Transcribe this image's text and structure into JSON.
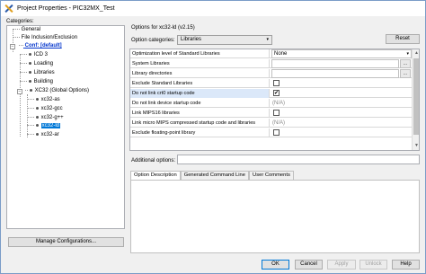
{
  "window": {
    "title": "Project Properties - PIC32MX_Test"
  },
  "categories": {
    "label": "Categories:",
    "items": [
      {
        "label": "General"
      },
      {
        "label": "File Inclusion/Exclusion"
      },
      {
        "label": "Conf: [default]"
      },
      {
        "label": "ICD 3"
      },
      {
        "label": "Loading"
      },
      {
        "label": "Libraries"
      },
      {
        "label": "Building"
      },
      {
        "label": "XC32 (Global Options)"
      },
      {
        "label": "xc32-as"
      },
      {
        "label": "xc32-gcc"
      },
      {
        "label": "xc32-g++"
      },
      {
        "label": "xc32-ld"
      },
      {
        "label": "xc32-ar"
      }
    ],
    "expander_collapse": "−"
  },
  "manage_button": "Manage Configurations...",
  "options_for": "Options for xc32-ld (v2.15)",
  "option_categories": {
    "label": "Option categories:",
    "value": "Libraries",
    "arrow": "▾"
  },
  "reset_button": "Reset",
  "grid": {
    "rows": [
      {
        "name": "Optimization level of Standard Libraries",
        "value": "None",
        "arrow": "▾"
      },
      {
        "name": "System Libraries",
        "ellipsis": "..."
      },
      {
        "name": "Library directories",
        "ellipsis": "..."
      },
      {
        "name": "Exclude Standard Libraries",
        "checked": false
      },
      {
        "name": "Do not link crt0 startup code",
        "checked": true,
        "check_mark": "✔"
      },
      {
        "name": "Do not link device startup code",
        "value": "(N/A)"
      },
      {
        "name": "Link MIPS16 libraries",
        "checked": false
      },
      {
        "name": "Link micro MIPS compressed startup code and libraries",
        "value": "(N/A)"
      },
      {
        "name": "Exclude floating-point library",
        "checked": false
      }
    ],
    "scroll_up": "▲",
    "scroll_down": "▼"
  },
  "additional_options": {
    "label": "Additional options:",
    "value": ""
  },
  "tabs": [
    {
      "label": "Option Description"
    },
    {
      "label": "Generated Command Line"
    },
    {
      "label": "User Comments"
    }
  ],
  "buttons": {
    "ok": "OK",
    "cancel": "Cancel",
    "apply": "Apply",
    "unlock": "Unlock",
    "help": "Help"
  }
}
